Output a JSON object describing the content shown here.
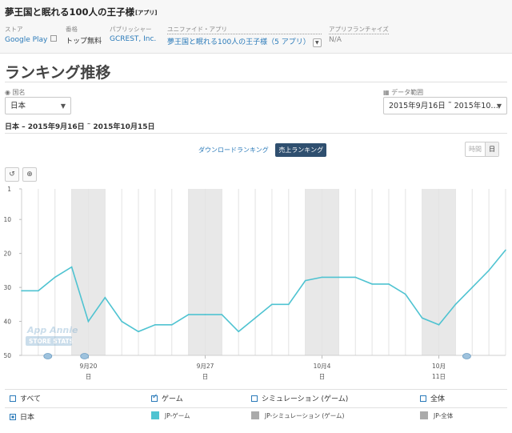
{
  "app": {
    "title": "夢王国と眠れる100人の王子様",
    "tag": "[アプリ]"
  },
  "meta": {
    "store_label": "ストア",
    "store_value": "Google Play",
    "rank_label": "番格",
    "rank_value": "トップ無料",
    "publisher_label": "パブリッシャー",
    "publisher_value": "GCREST, Inc.",
    "unified_label": "ユニファイド・アプリ",
    "unified_value": "夢王国と眠れる100人の王子様（5 アプリ）",
    "franchise_label": "アプリフランチャイズ",
    "franchise_value": "N/A"
  },
  "page": {
    "title": "ランキング推移"
  },
  "filters": {
    "country_label": "国名",
    "country_value": "日本",
    "date_label": "データ範囲",
    "date_value": "2015年9月16日 ˜ 2015年10…"
  },
  "range_title": "日本 – 2015年9月16日 ˜ 2015年10月15日",
  "tabs": {
    "download": "ダウンロードランキング",
    "revenue": "売上ランキング"
  },
  "granularity": {
    "hourly": "時間",
    "daily": "日"
  },
  "toolbar": {
    "reset_icon": "undo-icon",
    "zoom_icon": "zoom-icon"
  },
  "watermark": {
    "line1": "App Annie",
    "line2": "STORE STATS"
  },
  "chart_data": {
    "type": "line",
    "y_axis_inverted": true,
    "ylim": [
      1,
      50
    ],
    "y_ticks": [
      "1",
      "10",
      "20",
      "30",
      "40",
      "50"
    ],
    "x_ticks": [
      {
        "label": "9月20",
        "sub": "日"
      },
      {
        "label": "9月27",
        "sub": "日"
      },
      {
        "label": "10月4",
        "sub": "日"
      },
      {
        "label": "10月",
        "sub": "11日"
      }
    ],
    "x_dates": [
      "9/16",
      "9/17",
      "9/18",
      "9/19",
      "9/20",
      "9/21",
      "9/22",
      "9/23",
      "9/24",
      "9/25",
      "9/26",
      "9/27",
      "9/28",
      "9/29",
      "9/30",
      "10/1",
      "10/2",
      "10/3",
      "10/4",
      "10/5",
      "10/6",
      "10/7",
      "10/8",
      "10/9",
      "10/10",
      "10/11",
      "10/12",
      "10/13",
      "10/14",
      "10/15"
    ],
    "series": [
      {
        "name": "JP-ゲーム",
        "color": "#4fc3d1",
        "values": [
          31,
          31,
          27,
          24,
          40,
          33,
          40,
          43,
          41,
          41,
          38,
          38,
          38,
          43,
          39,
          35,
          35,
          28,
          27,
          27,
          27,
          29,
          29,
          32,
          39,
          41,
          35,
          30,
          25,
          19
        ]
      }
    ],
    "grid": true,
    "weekend_shading_color": "#e8e8e8"
  },
  "legend": {
    "row1": [
      {
        "label": "すべて",
        "checked": false
      },
      {
        "label": "ゲーム",
        "checked": true
      },
      {
        "label": "シミュレーション (ゲーム)",
        "checked": false
      },
      {
        "label": "全体",
        "checked": false
      }
    ],
    "country": "日本",
    "series_labels": [
      {
        "label": "JP-ゲーム",
        "color": "#4fc3d1"
      },
      {
        "label": "JP-シミュレーション (ゲーム)",
        "color": "#aaaaaa"
      },
      {
        "label": "JP-全体",
        "color": "#aaaaaa"
      }
    ]
  }
}
